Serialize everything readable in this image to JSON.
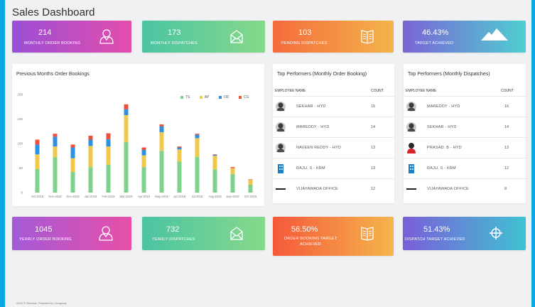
{
  "page": {
    "title": "Sales Dashboard"
  },
  "top_cards": [
    {
      "value": "214",
      "label": "MONTHLY ORDER BOOKING",
      "icon": "user-icon"
    },
    {
      "value": "173",
      "label": "MONTHLY DISPATCHES",
      "icon": "envelope-icon"
    },
    {
      "value": "103",
      "label": "PENDING DISPATCHES",
      "icon": "book-icon"
    },
    {
      "value": "46.43%",
      "label": "TARGET ACHIEVED",
      "icon": "mountain-icon"
    }
  ],
  "bottom_cards": [
    {
      "value": "1045",
      "label": "YEARLY ORDER BOOKING",
      "icon": "user-icon"
    },
    {
      "value": "732",
      "label": "YEARLY DISPATCHES",
      "icon": "envelope-icon"
    },
    {
      "value": "56.50%",
      "label": "ORDER BOOKING TARGET ACHIEVED",
      "icon": "book-icon"
    },
    {
      "value": "51.43%",
      "label": "DISPATCH TARGET ACHIEVED",
      "icon": "crosshair-icon"
    }
  ],
  "chart_panel": {
    "title": "Previous Months Order Bookings"
  },
  "chart_data": {
    "type": "bar",
    "stacked": true,
    "title": "Previous Months Order Bookings",
    "categories": [
      "Oct-2018",
      "Nov-2018",
      "Dec-2018",
      "Jan-2019",
      "Feb-2019",
      "Mar-2019",
      "Apr-2019",
      "May-2019",
      "Jun-2019",
      "Jul-2019",
      "Aug-2019",
      "Sep-2019",
      "Oct-2019"
    ],
    "series": [
      {
        "name": "TS",
        "color": "#7fd18b",
        "values": [
          48,
          72,
          42,
          52,
          57,
          103,
          52,
          85,
          63,
          73,
          47,
          38,
          16
        ]
      },
      {
        "name": "AP",
        "color": "#f0c84e",
        "values": [
          30,
          22,
          28,
          43,
          37,
          55,
          24,
          38,
          25,
          38,
          28,
          12,
          10
        ]
      },
      {
        "name": "OD",
        "color": "#2f8fe0",
        "values": [
          20,
          20,
          22,
          13,
          15,
          12,
          11,
          12,
          4,
          7,
          2,
          0,
          0
        ]
      },
      {
        "name": "CG",
        "color": "#f0503a",
        "values": [
          10,
          6,
          6,
          8,
          12,
          10,
          5,
          4,
          2,
          2,
          1,
          2,
          1
        ]
      }
    ],
    "ylim": [
      0,
      200
    ],
    "yticks": [
      0,
      50,
      100,
      150,
      200
    ],
    "grid": false,
    "legend_position": "top-right"
  },
  "performers_booking": {
    "title": "Top Performers (Monthly Order Booking)",
    "col_name": "EMPLOYEE NAME",
    "col_count": "COUNT",
    "rows": [
      {
        "name": "SEKHAR - HYD",
        "count": "15",
        "avatar": "person-avatar-icon"
      },
      {
        "name": "MAREDDY - HYD",
        "count": "14",
        "avatar": "person-avatar-icon"
      },
      {
        "name": "NAVEEN REDDY - HYD",
        "count": "13",
        "avatar": "person-avatar-icon"
      },
      {
        "name": "RAJU. S - KRM",
        "count": "13",
        "avatar": "building-avatar-icon"
      },
      {
        "name": "VIJAYAWADA OFFICE",
        "count": "12",
        "avatar": "genesis-logo"
      }
    ]
  },
  "performers_dispatch": {
    "title": "Top Performers (Monthly Dispatches)",
    "col_name": "EMPLOYEE NAME",
    "col_count": "COUNT",
    "rows": [
      {
        "name": "MAREDDY - HYD",
        "count": "16",
        "avatar": "person-avatar-icon"
      },
      {
        "name": "SEKHAR - HYD",
        "count": "14",
        "avatar": "person-avatar-icon"
      },
      {
        "name": "PRASAD. B - HYD",
        "count": "13",
        "avatar": "person-red-avatar-icon"
      },
      {
        "name": "RAJU. S - KRM",
        "count": "12",
        "avatar": "building-avatar-icon"
      },
      {
        "name": "VIJAYAWADA OFFICE",
        "count": "8",
        "avatar": "genesis-logo"
      }
    ]
  },
  "footer": {
    "text": "2019 © Genesis. Powered by Cengroup"
  }
}
